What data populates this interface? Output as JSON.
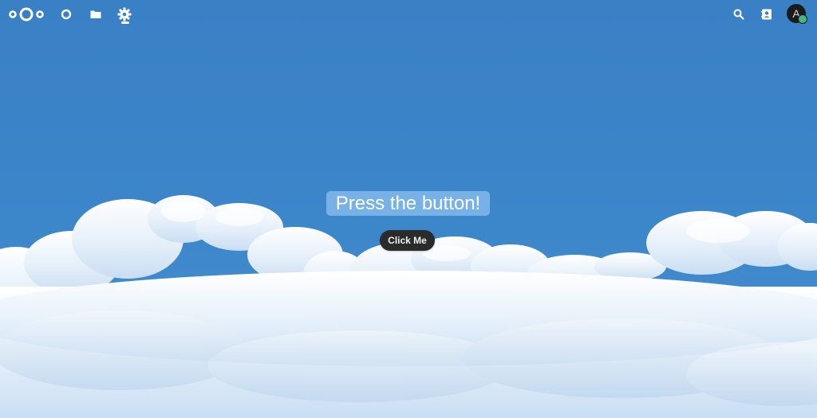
{
  "header": {
    "apps": [
      {
        "name": "Dashboard",
        "icon": "dashboard-icon"
      },
      {
        "name": "Files",
        "icon": "folder-icon"
      },
      {
        "name": "Settings",
        "icon": "gear-icon",
        "active": true
      }
    ],
    "right_icons": [
      "search-icon",
      "contacts-icon"
    ],
    "avatar_initial": "A",
    "status_color": "#49b382"
  },
  "main": {
    "headline": "Press the button!",
    "button_label": "Click Me"
  },
  "colors": {
    "sky": "#3a82c6",
    "button": "#2b2b2b",
    "headline_bg": "#82b9eb"
  }
}
